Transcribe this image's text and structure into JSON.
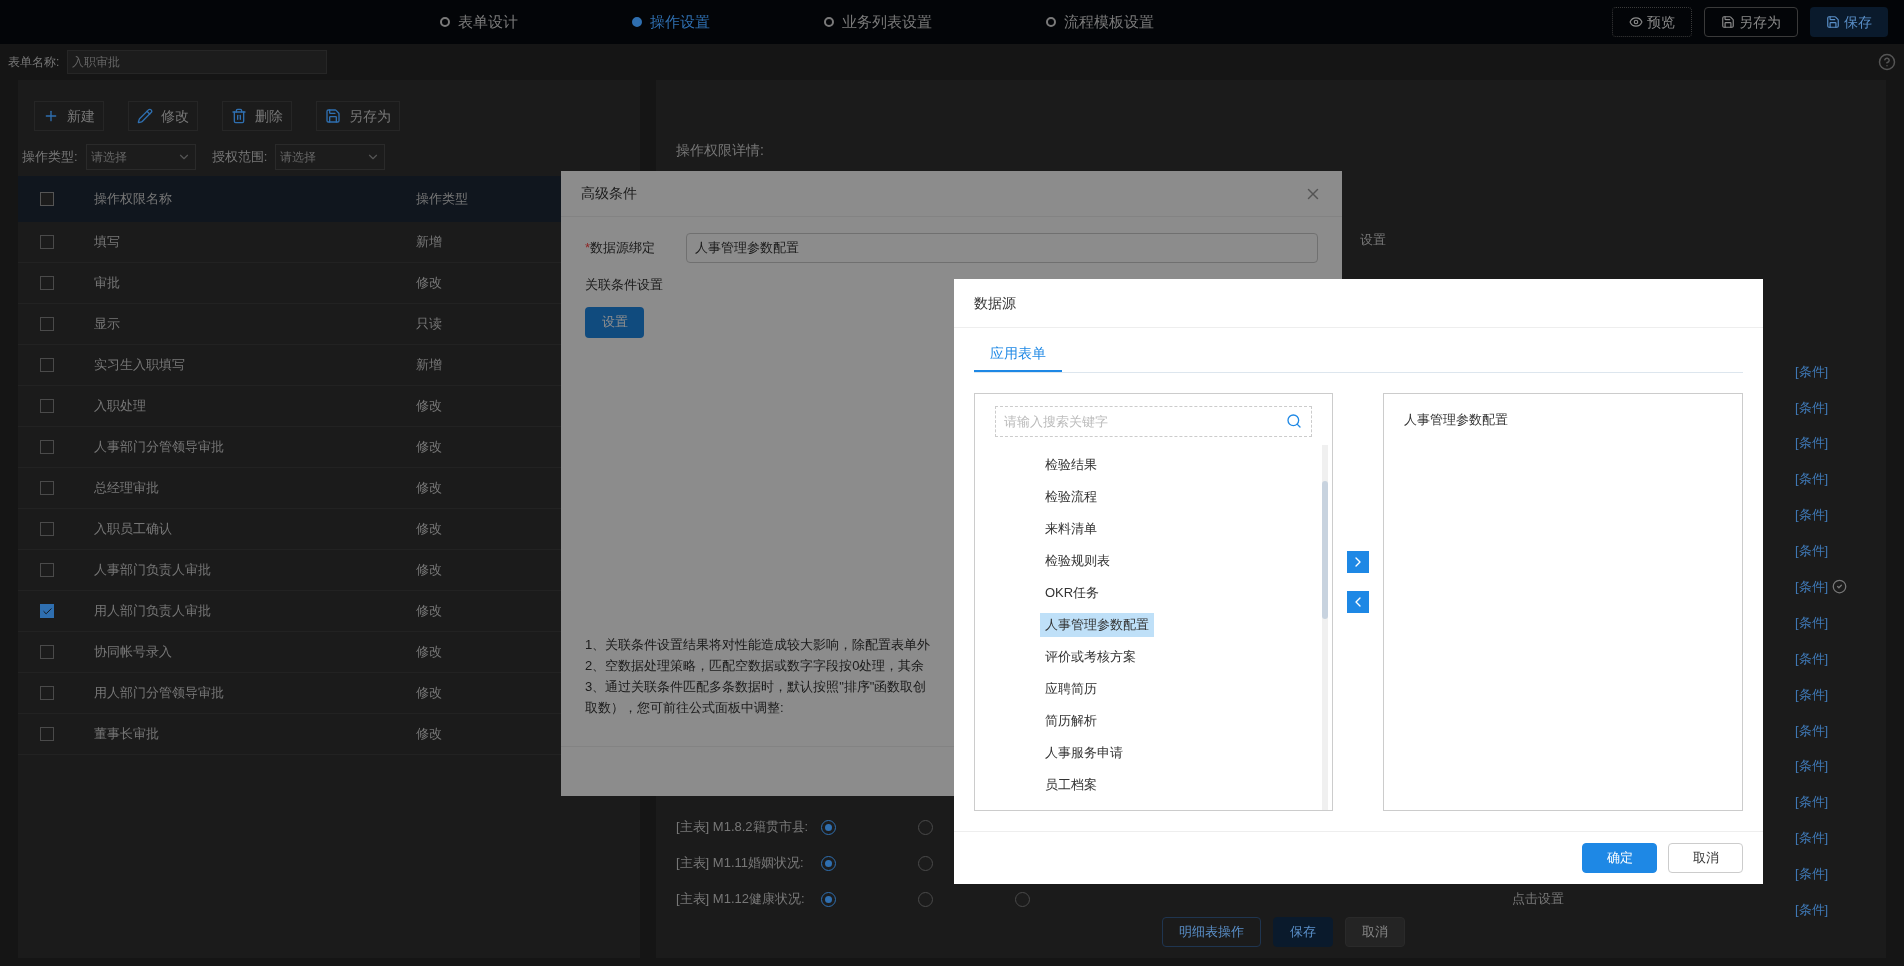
{
  "top_bar": {
    "steps": [
      {
        "label": "表单设计",
        "selected": false
      },
      {
        "label": "操作设置",
        "selected": true
      },
      {
        "label": "业务列表设置",
        "selected": false
      },
      {
        "label": "流程模板设置",
        "selected": false
      }
    ],
    "actions": [
      {
        "label": "预览",
        "kind": "link"
      },
      {
        "label": "另存为",
        "kind": "outline"
      },
      {
        "label": "保存",
        "kind": "primary"
      }
    ]
  },
  "form_name": {
    "label": "表单名称:",
    "value": "入职审批"
  },
  "toolbar": [
    {
      "label": "新建",
      "kind": "add"
    },
    {
      "label": "修改",
      "kind": "edit"
    },
    {
      "label": "删除",
      "kind": "delete"
    },
    {
      "label": "另存为",
      "kind": "saveas"
    }
  ],
  "filters": [
    {
      "label": "操作类型:",
      "placeholder": "请选择"
    },
    {
      "label": "授权范围:",
      "placeholder": "请选择"
    }
  ],
  "table": {
    "columns": [
      "操作权限名称",
      "操作类型"
    ],
    "header_checked": false,
    "rows": [
      {
        "name": "填写",
        "type": "新增",
        "checked": false
      },
      {
        "name": "审批",
        "type": "修改",
        "checked": false
      },
      {
        "name": "显示",
        "type": "只读",
        "checked": false
      },
      {
        "name": "实习生入职填写",
        "type": "新增",
        "checked": false
      },
      {
        "name": "入职处理",
        "type": "修改",
        "checked": false
      },
      {
        "name": "人事部门分管领导审批",
        "type": "修改",
        "checked": false
      },
      {
        "name": "总经理审批",
        "type": "修改",
        "checked": false
      },
      {
        "name": "入职员工确认",
        "type": "修改",
        "checked": false
      },
      {
        "name": "人事部门负责人审批",
        "type": "修改",
        "checked": false
      },
      {
        "name": "用人部门负责人审批",
        "type": "修改",
        "checked": true
      },
      {
        "name": "协同帐号录入",
        "type": "修改",
        "checked": false
      },
      {
        "name": "用人部门分管领导审批",
        "type": "修改",
        "checked": false
      },
      {
        "name": "董事长审批",
        "type": "修改",
        "checked": false
      }
    ]
  },
  "detail": {
    "title": "操作权限详情:",
    "setting_label": "设置",
    "condition_links": [
      {
        "label": "[条件]",
        "verified": false
      },
      {
        "label": "[条件]",
        "verified": false
      },
      {
        "label": "[条件]",
        "verified": false
      },
      {
        "label": "[条件]",
        "verified": false
      },
      {
        "label": "[条件]",
        "verified": false
      },
      {
        "label": "[条件]",
        "verified": false
      },
      {
        "label": "[条件]",
        "verified": true
      },
      {
        "label": "[条件]",
        "verified": false
      },
      {
        "label": "[条件]",
        "verified": false
      },
      {
        "label": "[条件]",
        "verified": false
      },
      {
        "label": "[条件]",
        "verified": false
      },
      {
        "label": "[条件]",
        "verified": false
      },
      {
        "label": "[条件]",
        "verified": false
      },
      {
        "label": "[条件]",
        "verified": false
      },
      {
        "label": "[条件]",
        "verified": false
      },
      {
        "label": "[条件]",
        "verified": false
      }
    ],
    "fields": [
      {
        "label": "[主表] M1.8.2籍贯市县:",
        "options": [
          {
            "selected": true
          },
          {
            "selected": false
          }
        ]
      },
      {
        "label": "[主表] M1.11婚姻状况:",
        "options": [
          {
            "selected": true
          },
          {
            "selected": false
          }
        ]
      },
      {
        "label": "[主表] M1.12健康状况:",
        "options": [
          {
            "selected": true
          },
          {
            "selected": false
          },
          {
            "selected": false
          }
        ]
      }
    ],
    "click_hint": "点击设置",
    "buttons": [
      {
        "label": "明细表操作",
        "kind": "outline"
      },
      {
        "label": "保存",
        "kind": "primary"
      },
      {
        "label": "取消",
        "kind": "plain"
      }
    ]
  },
  "advanced_dialog": {
    "title": "高级条件",
    "field": {
      "required": true,
      "required_mark": "*",
      "label": "数据源绑定",
      "value": "人事管理参数配置"
    },
    "section": "关联条件设置",
    "button": "设置",
    "notes": [
      "1、关联条件设置结果将对性能造成较大影响，除配置表单外",
      "2、空数据处理策略，匹配空数据或数字字段按0处理，其余",
      "3、通过关联条件匹配多条数据时，默认按照\"排序\"函数取创",
      "取数），您可前往公式面板中调整:"
    ]
  },
  "datasource_dialog": {
    "title": "数据源",
    "tabs": [
      {
        "label": "应用表单",
        "selected": true
      }
    ],
    "search": {
      "placeholder": "请输入搜索关键字"
    },
    "items": [
      {
        "label": "检验结果",
        "selected": false
      },
      {
        "label": "检验流程",
        "selected": false
      },
      {
        "label": "来料清单",
        "selected": false
      },
      {
        "label": "检验规则表",
        "selected": false
      },
      {
        "label": "OKR任务",
        "selected": false
      },
      {
        "label": "人事管理参数配置",
        "selected": true
      },
      {
        "label": "评价或考核方案",
        "selected": false
      },
      {
        "label": "应聘简历",
        "selected": false
      },
      {
        "label": "简历解析",
        "selected": false
      },
      {
        "label": "人事服务申请",
        "selected": false
      },
      {
        "label": "员工档案",
        "selected": false
      }
    ],
    "chosen": [
      "人事管理参数配置"
    ],
    "buttons": [
      {
        "label": "确定",
        "kind": "primary"
      },
      {
        "label": "取消",
        "kind": "plain"
      }
    ]
  }
}
